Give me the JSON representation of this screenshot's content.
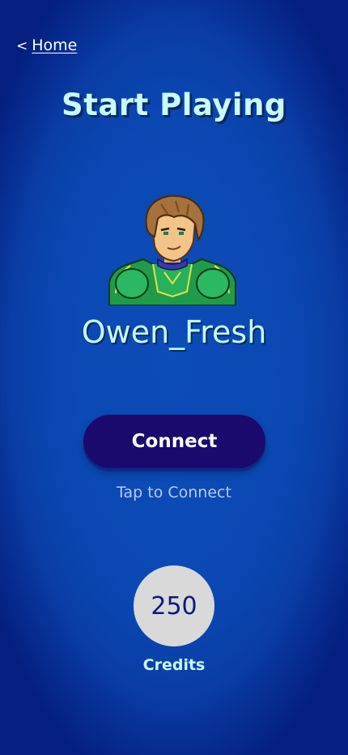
{
  "nav": {
    "back_chevron": "<",
    "back_label": "Home"
  },
  "title": "Start Playing",
  "player": {
    "username": "Owen_Fresh",
    "avatar_icon": "pixel-knight-avatar"
  },
  "connect": {
    "button_label": "Connect",
    "hint": "Tap to Connect"
  },
  "credits": {
    "value": "250",
    "label": "Credits"
  },
  "colors": {
    "background": "#0b48b3",
    "accent_text": "#c8faff",
    "button": "#1a0a6e",
    "credits_circle": "#d9d9d9"
  }
}
